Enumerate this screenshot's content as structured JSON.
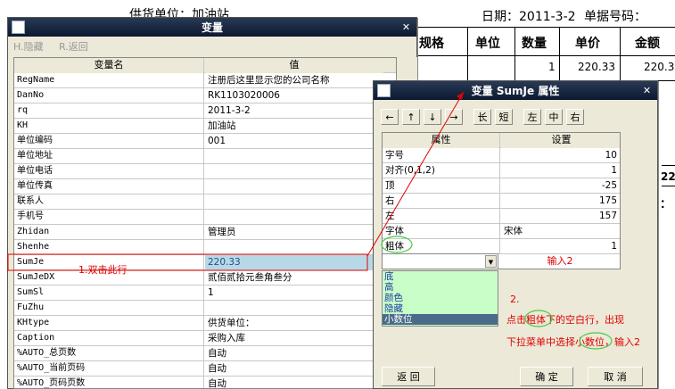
{
  "report": {
    "supplier_label": "供货单位：加油站",
    "date_label": "日期：2011-3-2",
    "docno_label": "单据号码：",
    "headers": [
      "规格",
      "单位",
      "数量",
      "单价",
      "金额"
    ],
    "row_qty": "1",
    "row_price": "220.33",
    "row_amount": "220.3",
    "partial_22": "22",
    "colon": "："
  },
  "var_window": {
    "title": "变量",
    "toolbar": {
      "hide": "H.隐藏",
      "back": "R.返回"
    },
    "col_name": "变量名",
    "col_value": "值",
    "rows": [
      {
        "name": "RegName",
        "value": "注册后这里显示您的公司名称"
      },
      {
        "name": "DanNo",
        "value": "RK1103020006"
      },
      {
        "name": "rq",
        "value": "2011-3-2"
      },
      {
        "name": "KH",
        "value": "加油站"
      },
      {
        "name": "单位编码",
        "value": "001"
      },
      {
        "name": "单位地址",
        "value": ""
      },
      {
        "name": "单位电话",
        "value": ""
      },
      {
        "name": "单位传真",
        "value": ""
      },
      {
        "name": "联系人",
        "value": ""
      },
      {
        "name": "手机号",
        "value": ""
      },
      {
        "name": "Zhidan",
        "value": "管理员"
      },
      {
        "name": "Shenhe",
        "value": ""
      },
      {
        "name": "SumJe",
        "value": "220.33"
      },
      {
        "name": "SumJeDX",
        "value": "贰佰贰拾元叁角叁分"
      },
      {
        "name": "SumSl",
        "value": "1"
      },
      {
        "name": "FuZhu",
        "value": ""
      },
      {
        "name": "KHtype",
        "value": "供货单位："
      },
      {
        "name": "Caption",
        "value": "采购入库"
      },
      {
        "name": "%AUTO_总页数",
        "value": "自动"
      },
      {
        "name": "%AUTO_当前页码",
        "value": "自动"
      },
      {
        "name": "%AUTO_页码页数",
        "value": "自动"
      }
    ]
  },
  "prop_window": {
    "title": "变量 SumJe 属性",
    "arrows": [
      "←",
      "↑",
      "↓",
      "→"
    ],
    "size_btns": [
      "长",
      "短"
    ],
    "align_btns": [
      "左",
      "中",
      "右"
    ],
    "col_prop": "属性",
    "col_setting": "设置",
    "rows": [
      {
        "name": "字号",
        "value": "10"
      },
      {
        "name": "对齐(0,1,2)",
        "value": "1"
      },
      {
        "name": "顶",
        "value": "-25"
      },
      {
        "name": "右",
        "value": "175"
      },
      {
        "name": "左",
        "value": "157"
      },
      {
        "name": "字体",
        "value": "宋体"
      },
      {
        "name": "粗体",
        "value": "1"
      }
    ],
    "input2": "输入2",
    "dropdown_options": [
      "底",
      "高",
      "颜色",
      "隐藏",
      "小数位"
    ],
    "btn_back": "返 回",
    "btn_ok": "确 定",
    "btn_cancel": "取 消"
  },
  "annotations": {
    "a1": "1.双击此行",
    "a2_num": "2.",
    "a2_line1": "点击粗体下的空白行，出现",
    "a2_line2": "下拉菜单中选择小数位，输入2"
  },
  "colors": {
    "annotation": "#e00000",
    "selected": "#4a6b8a",
    "highlight": "#b8d8e8",
    "dropdown_bg": "#c8ffc8"
  }
}
